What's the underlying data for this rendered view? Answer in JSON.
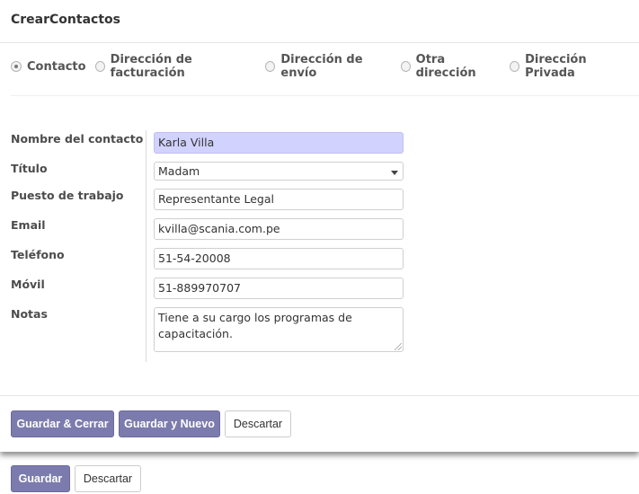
{
  "dialog": {
    "title": "CrearContactos"
  },
  "address_types": [
    {
      "label": "Contacto",
      "checked": true
    },
    {
      "label": "Dirección de facturación",
      "checked": false
    },
    {
      "label": "Dirección de envío",
      "checked": false
    },
    {
      "label": "Otra dirección",
      "checked": false
    },
    {
      "label": "Dirección Privada",
      "checked": false
    }
  ],
  "form": {
    "name_label": "Nombre del contacto",
    "name_value": "Karla Villa",
    "title_label": "Título",
    "title_value": "Madam",
    "job_label": "Puesto de trabajo",
    "job_value": "Representante Legal",
    "email_label": "Email",
    "email_value": "kvilla@scania.com.pe",
    "phone_label": "Teléfono",
    "phone_value": "51-54-20008",
    "mobile_label": "Móvil",
    "mobile_value": "51-889970707",
    "notes_label": "Notas",
    "notes_value": "Tiene a su cargo los programas de capacitación."
  },
  "footer": {
    "save_close_label": "Guardar & Cerrar",
    "save_new_label": "Guardar y Nuevo",
    "discard_label": "Descartar"
  },
  "background_form": {
    "save_label": "Guardar",
    "discard_label": "Descartar"
  },
  "colors": {
    "primary": "#7c7bad",
    "required_field": "#d2d2ff"
  }
}
